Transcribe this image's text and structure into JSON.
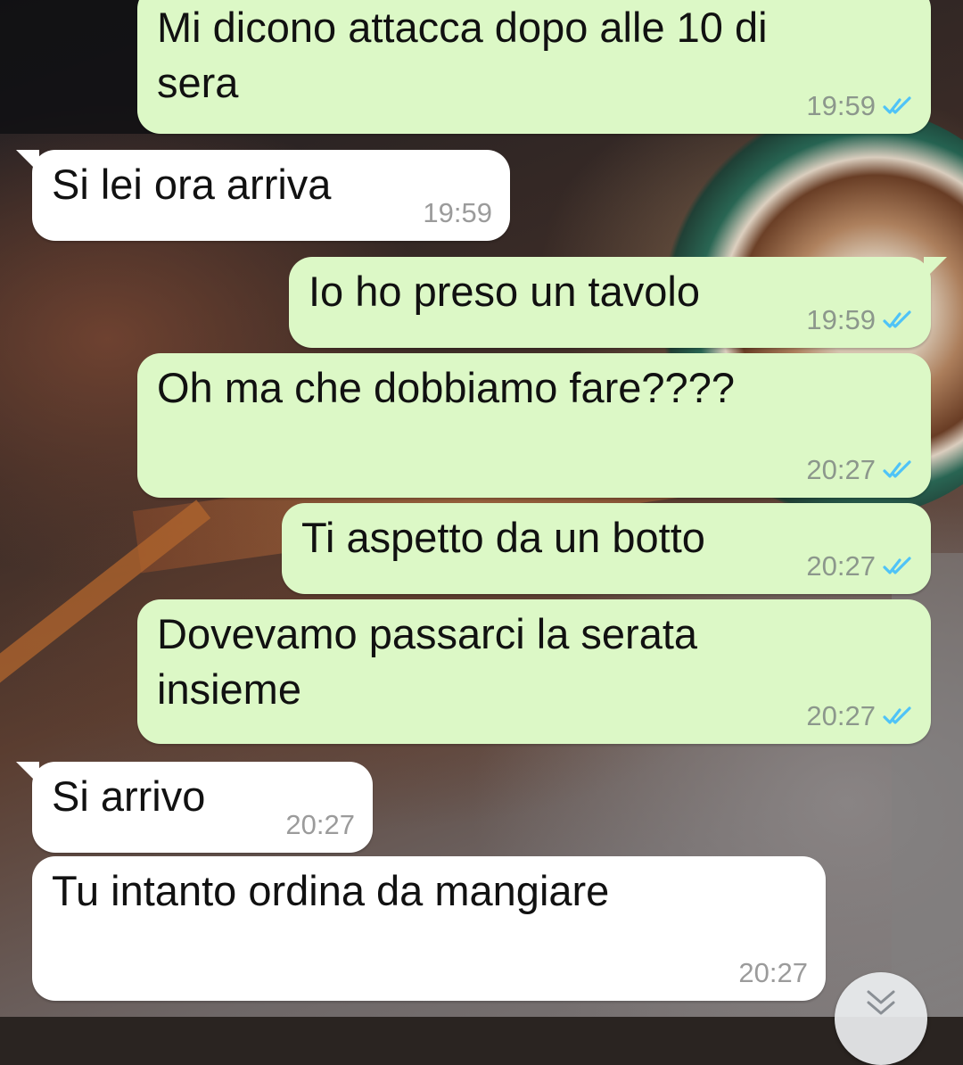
{
  "messages": [
    {
      "dir": "out",
      "text": "Mi dicono attacca dopo alle 10 di\nsera",
      "time": "19:59",
      "status": "read"
    },
    {
      "dir": "in",
      "text": "Si lei ora arriva",
      "time": "19:59"
    },
    {
      "dir": "out",
      "text": "Io ho preso un tavolo",
      "time": "19:59",
      "status": "read"
    },
    {
      "dir": "out",
      "text": "Oh ma che dobbiamo fare????",
      "time": "20:27",
      "status": "read"
    },
    {
      "dir": "out",
      "text": "Ti aspetto da un botto",
      "time": "20:27",
      "status": "read"
    },
    {
      "dir": "out",
      "text": "Dovevamo passarci la serata\ninsieme",
      "time": "20:27",
      "status": "read"
    },
    {
      "dir": "in",
      "text": "Si arrivo",
      "time": "20:27"
    },
    {
      "dir": "in",
      "text": "Tu intanto ordina da mangiare",
      "time": "20:27"
    }
  ],
  "icons": {
    "read_receipt": "double-check-icon",
    "scroll_down": "double-chevron-down-icon"
  },
  "colors": {
    "outgoing_bubble": "#dcf8c6",
    "incoming_bubble": "#ffffff",
    "read_tick": "#4fc3f7",
    "timestamp": "#8c978c"
  }
}
